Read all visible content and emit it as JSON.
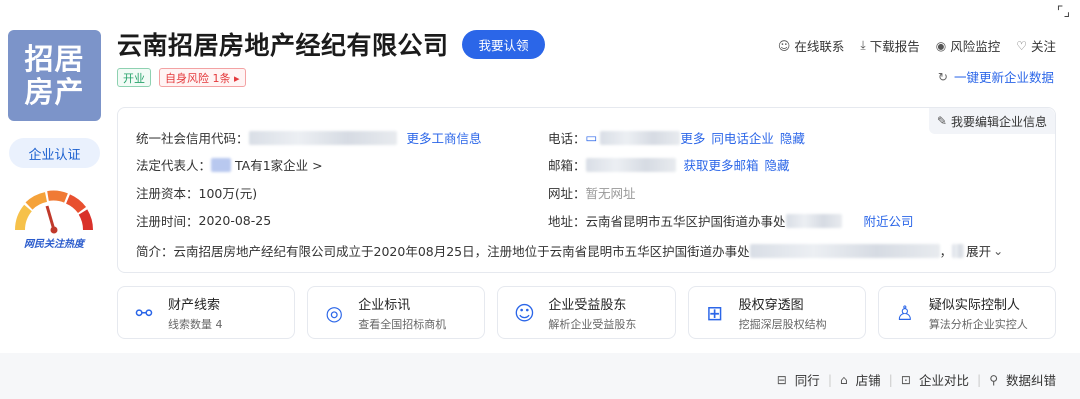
{
  "logo": {
    "line1": "招居",
    "line2": "房产"
  },
  "cert_label": "企业认证",
  "heat_label": "网民关注热度",
  "company_name": "云南招居房地产经纪有限公司",
  "claim_button": "我要认领",
  "tags": {
    "status": "开业",
    "risk": "自身风险 1条 ▸"
  },
  "top_actions": [
    {
      "icon": "chat-icon",
      "label": "在线联系"
    },
    {
      "icon": "download-icon",
      "label": "下载报告"
    },
    {
      "icon": "eye-icon",
      "label": "风险监控"
    },
    {
      "icon": "heart-icon",
      "label": "关注"
    }
  ],
  "update_label": "一键更新企业数据",
  "edit_label": "我要编辑企业信息",
  "info": {
    "credit_code_label": "统一社会信用代码：",
    "more_business": "更多工商信息",
    "legal_rep_label": "法定代表人：",
    "legal_rep_suffix": "TA有1家企业 >",
    "capital_label": "注册资本：",
    "capital_value": "100万(元)",
    "reg_time_label": "注册时间：",
    "reg_time_value": "2020-08-25",
    "phone_label": "电话：",
    "phone_more": "更多",
    "phone_same": "同电话企业",
    "phone_hide": "隐藏",
    "email_label": "邮箱：",
    "email_more": "获取更多邮箱",
    "email_hide": "隐藏",
    "website_label": "网址：",
    "website_value": "暂无网址",
    "address_label": "地址：",
    "address_value": "云南省昆明市五华区护国街道办事处",
    "address_nearby": "附近公司",
    "intro_label": "简介：",
    "intro_value": "云南招居房地产经纪有限公司成立于2020年08月25日，注册地位于云南省昆明市五华区护国街道办事处",
    "intro_tail": "，",
    "expand": "展开"
  },
  "cards": [
    {
      "icon": "clue-icon",
      "title": "财产线索",
      "sub": "线索数量 4"
    },
    {
      "icon": "target-icon",
      "title": "企业标讯",
      "sub": "查看全国招标商机"
    },
    {
      "icon": "shareholder-icon",
      "title": "企业受益股东",
      "sub": "解析企业受益股东"
    },
    {
      "icon": "equity-icon",
      "title": "股权穿透图",
      "sub": "挖掘深层股权结构"
    },
    {
      "icon": "controller-icon",
      "title": "疑似实际控制人",
      "sub": "算法分析企业实控人"
    }
  ],
  "bottom_actions": [
    {
      "icon": "peer-icon",
      "label": "同行"
    },
    {
      "icon": "shop-icon",
      "label": "店铺"
    },
    {
      "icon": "compare-icon",
      "label": "企业对比"
    },
    {
      "icon": "correct-icon",
      "label": "数据纠错"
    }
  ]
}
